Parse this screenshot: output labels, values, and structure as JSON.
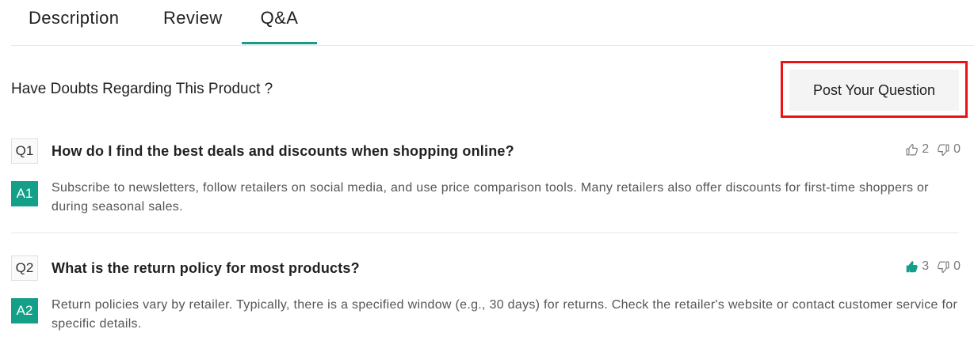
{
  "tabs": [
    {
      "label": "Description",
      "active": false
    },
    {
      "label": "Review",
      "active": false
    },
    {
      "label": "Q&A",
      "active": true
    }
  ],
  "qa_header": {
    "prompt": "Have Doubts Regarding This Product ?",
    "post_button_label": "Post Your Question"
  },
  "colors": {
    "accent": "#1a9b8a",
    "highlight_box": "#ee1111"
  },
  "items": [
    {
      "q_badge": "Q1",
      "question": "How do I find the best deals and discounts when shopping online?",
      "a_badge": "A1",
      "answer": "Subscribe to newsletters, follow retailers on social media, and use price comparison tools. Many retailers also offer discounts for first-time shoppers or during seasonal sales.",
      "likes": "2",
      "dislikes": "0",
      "liked": false
    },
    {
      "q_badge": "Q2",
      "question": "What is the return policy for most products?",
      "a_badge": "A2",
      "answer": "Return policies vary by retailer. Typically, there is a specified window (e.g., 30 days) for returns. Check the retailer's website or contact customer service for specific details.",
      "likes": "3",
      "dislikes": "0",
      "liked": true
    }
  ]
}
